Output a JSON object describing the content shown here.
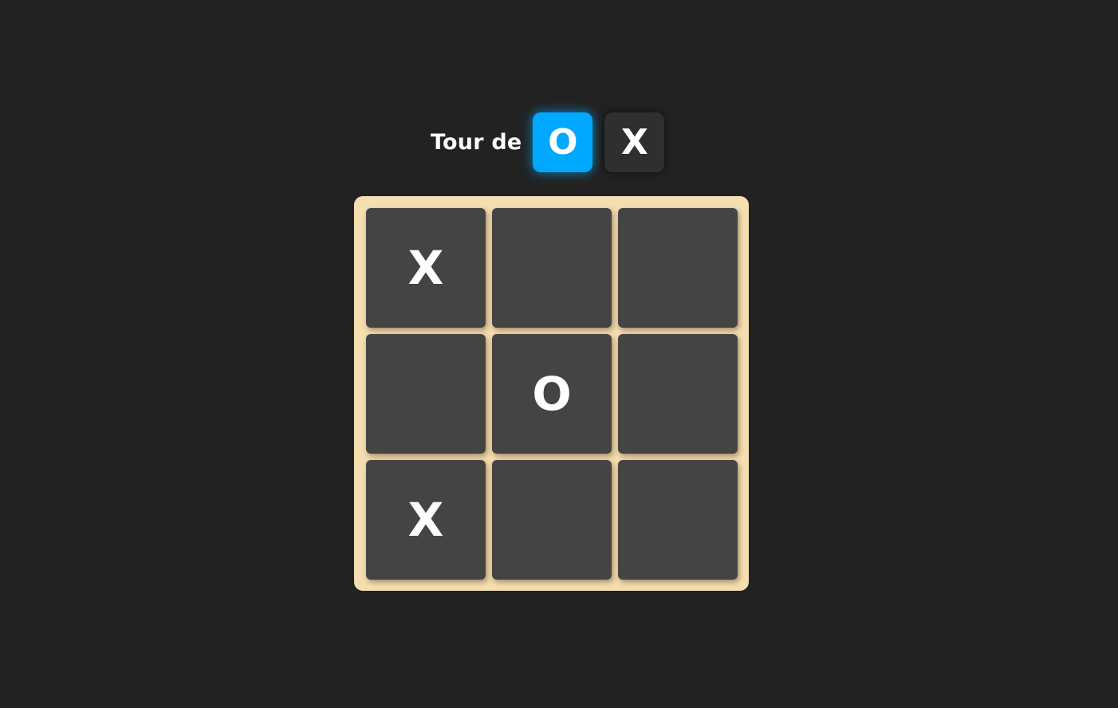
{
  "turn": {
    "label": "Tour de",
    "current_player": "O",
    "other_player": "X"
  },
  "board": {
    "cells": [
      "X",
      "",
      "",
      "",
      "O",
      "",
      "X",
      "",
      ""
    ]
  },
  "colors": {
    "background": "#222222",
    "board_frame": "#f5deb0",
    "cell": "#444444",
    "active_player": "#00a8ff",
    "inactive_player": "#2f2f2f",
    "text": "#ffffff"
  }
}
